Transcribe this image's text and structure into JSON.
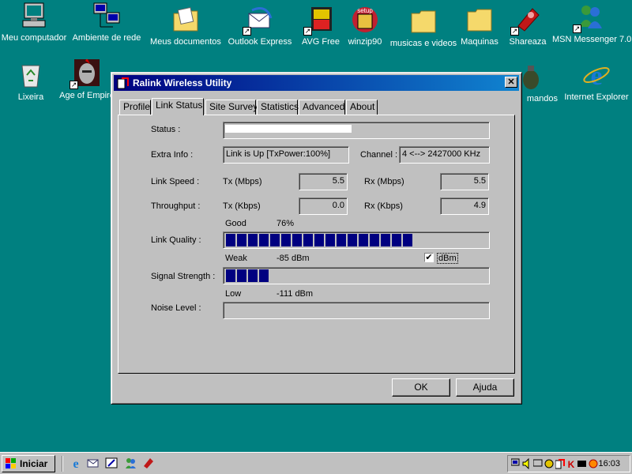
{
  "desktop": {
    "icons": [
      {
        "label": "Meu computador",
        "icon": "computer-icon"
      },
      {
        "label": "Ambiente de rede",
        "icon": "network-icon"
      },
      {
        "label": "Meus documentos",
        "icon": "documents-folder-icon"
      },
      {
        "label": "Outlook Express",
        "icon": "outlook-icon"
      },
      {
        "label": "AVG Free",
        "icon": "avg-icon"
      },
      {
        "label": "winzip90",
        "icon": "winzip-setup-icon"
      },
      {
        "label": "musicas e videos",
        "icon": "folder-icon"
      },
      {
        "label": "Maquinas",
        "icon": "folder-icon"
      },
      {
        "label": "Shareaza",
        "icon": "shareaza-icon"
      },
      {
        "label": "MSN Messenger 7.0",
        "icon": "msn-icon"
      },
      {
        "label": "Lixeira",
        "icon": "recycle-bin-icon"
      },
      {
        "label": "Age of Empire",
        "icon": "age-of-empires-icon"
      },
      {
        "label": "mandos",
        "icon": "grenade-icon"
      },
      {
        "label": "Internet Explorer",
        "icon": "internet-explorer-icon"
      }
    ]
  },
  "window": {
    "title": "Ralink Wireless Utility",
    "close_symbol": "✕",
    "tabs": [
      "Profile",
      "Link Status",
      "Site Survey",
      "Statistics",
      "Advanced",
      "About"
    ],
    "active_tab": "Link Status",
    "status_label": "Status :",
    "extra_info_label": "Extra Info :",
    "extra_info_value": "Link is Up [TxPower:100%]",
    "channel_label": "Channel :",
    "channel_value": "4 <--> 2427000 KHz",
    "link_speed_label": "Link Speed :",
    "tx_mbps_label": "Tx (Mbps)",
    "tx_mbps_value": "5.5",
    "rx_mbps_label": "Rx (Mbps)",
    "rx_mbps_value": "5.5",
    "throughput_label": "Throughput :",
    "tx_kbps_label": "Tx (Kbps)",
    "tx_kbps_value": "0.0",
    "rx_kbps_label": "Rx (Kbps)",
    "rx_kbps_value": "4.9",
    "quality_word": "Good",
    "quality_percent": "76%",
    "link_quality_label": "Link Quality :",
    "link_quality_level": 0.76,
    "signal_word": "Weak",
    "signal_dbm": "-85 dBm",
    "dbm_checkbox_label": "dBm",
    "dbm_checked": true,
    "check_mark": "✔",
    "signal_strength_label": "Signal Strength :",
    "signal_strength_level": 0.17,
    "noise_word": "Low",
    "noise_dbm": "-111 dBm",
    "noise_level_label": "Noise Level :",
    "ok_label": "OK",
    "help_label": "Ajuda"
  },
  "taskbar": {
    "start_label": "Iniciar",
    "clock": "16:03"
  },
  "colors": {
    "desktop": "#008080",
    "titlebar": "#000080",
    "bar_fill": "#000080"
  }
}
